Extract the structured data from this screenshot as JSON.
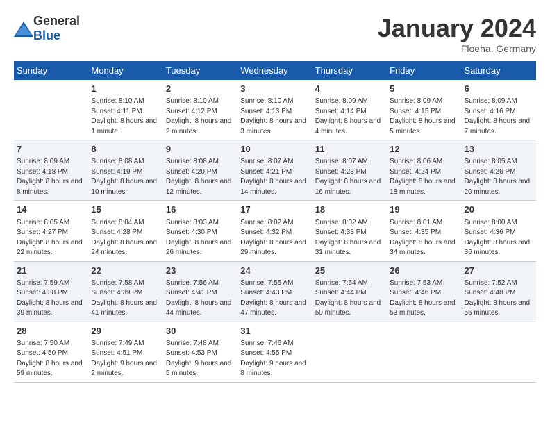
{
  "header": {
    "logo_general": "General",
    "logo_blue": "Blue",
    "month_title": "January 2024",
    "location": "Floeha, Germany"
  },
  "weekdays": [
    "Sunday",
    "Monday",
    "Tuesday",
    "Wednesday",
    "Thursday",
    "Friday",
    "Saturday"
  ],
  "weeks": [
    [
      {
        "day": "",
        "sunrise": "",
        "sunset": "",
        "daylight": ""
      },
      {
        "day": "1",
        "sunrise": "Sunrise: 8:10 AM",
        "sunset": "Sunset: 4:11 PM",
        "daylight": "Daylight: 8 hours and 1 minute."
      },
      {
        "day": "2",
        "sunrise": "Sunrise: 8:10 AM",
        "sunset": "Sunset: 4:12 PM",
        "daylight": "Daylight: 8 hours and 2 minutes."
      },
      {
        "day": "3",
        "sunrise": "Sunrise: 8:10 AM",
        "sunset": "Sunset: 4:13 PM",
        "daylight": "Daylight: 8 hours and 3 minutes."
      },
      {
        "day": "4",
        "sunrise": "Sunrise: 8:09 AM",
        "sunset": "Sunset: 4:14 PM",
        "daylight": "Daylight: 8 hours and 4 minutes."
      },
      {
        "day": "5",
        "sunrise": "Sunrise: 8:09 AM",
        "sunset": "Sunset: 4:15 PM",
        "daylight": "Daylight: 8 hours and 5 minutes."
      },
      {
        "day": "6",
        "sunrise": "Sunrise: 8:09 AM",
        "sunset": "Sunset: 4:16 PM",
        "daylight": "Daylight: 8 hours and 7 minutes."
      }
    ],
    [
      {
        "day": "7",
        "sunrise": "Sunrise: 8:09 AM",
        "sunset": "Sunset: 4:18 PM",
        "daylight": "Daylight: 8 hours and 8 minutes."
      },
      {
        "day": "8",
        "sunrise": "Sunrise: 8:08 AM",
        "sunset": "Sunset: 4:19 PM",
        "daylight": "Daylight: 8 hours and 10 minutes."
      },
      {
        "day": "9",
        "sunrise": "Sunrise: 8:08 AM",
        "sunset": "Sunset: 4:20 PM",
        "daylight": "Daylight: 8 hours and 12 minutes."
      },
      {
        "day": "10",
        "sunrise": "Sunrise: 8:07 AM",
        "sunset": "Sunset: 4:21 PM",
        "daylight": "Daylight: 8 hours and 14 minutes."
      },
      {
        "day": "11",
        "sunrise": "Sunrise: 8:07 AM",
        "sunset": "Sunset: 4:23 PM",
        "daylight": "Daylight: 8 hours and 16 minutes."
      },
      {
        "day": "12",
        "sunrise": "Sunrise: 8:06 AM",
        "sunset": "Sunset: 4:24 PM",
        "daylight": "Daylight: 8 hours and 18 minutes."
      },
      {
        "day": "13",
        "sunrise": "Sunrise: 8:05 AM",
        "sunset": "Sunset: 4:26 PM",
        "daylight": "Daylight: 8 hours and 20 minutes."
      }
    ],
    [
      {
        "day": "14",
        "sunrise": "Sunrise: 8:05 AM",
        "sunset": "Sunset: 4:27 PM",
        "daylight": "Daylight: 8 hours and 22 minutes."
      },
      {
        "day": "15",
        "sunrise": "Sunrise: 8:04 AM",
        "sunset": "Sunset: 4:28 PM",
        "daylight": "Daylight: 8 hours and 24 minutes."
      },
      {
        "day": "16",
        "sunrise": "Sunrise: 8:03 AM",
        "sunset": "Sunset: 4:30 PM",
        "daylight": "Daylight: 8 hours and 26 minutes."
      },
      {
        "day": "17",
        "sunrise": "Sunrise: 8:02 AM",
        "sunset": "Sunset: 4:32 PM",
        "daylight": "Daylight: 8 hours and 29 minutes."
      },
      {
        "day": "18",
        "sunrise": "Sunrise: 8:02 AM",
        "sunset": "Sunset: 4:33 PM",
        "daylight": "Daylight: 8 hours and 31 minutes."
      },
      {
        "day": "19",
        "sunrise": "Sunrise: 8:01 AM",
        "sunset": "Sunset: 4:35 PM",
        "daylight": "Daylight: 8 hours and 34 minutes."
      },
      {
        "day": "20",
        "sunrise": "Sunrise: 8:00 AM",
        "sunset": "Sunset: 4:36 PM",
        "daylight": "Daylight: 8 hours and 36 minutes."
      }
    ],
    [
      {
        "day": "21",
        "sunrise": "Sunrise: 7:59 AM",
        "sunset": "Sunset: 4:38 PM",
        "daylight": "Daylight: 8 hours and 39 minutes."
      },
      {
        "day": "22",
        "sunrise": "Sunrise: 7:58 AM",
        "sunset": "Sunset: 4:39 PM",
        "daylight": "Daylight: 8 hours and 41 minutes."
      },
      {
        "day": "23",
        "sunrise": "Sunrise: 7:56 AM",
        "sunset": "Sunset: 4:41 PM",
        "daylight": "Daylight: 8 hours and 44 minutes."
      },
      {
        "day": "24",
        "sunrise": "Sunrise: 7:55 AM",
        "sunset": "Sunset: 4:43 PM",
        "daylight": "Daylight: 8 hours and 47 minutes."
      },
      {
        "day": "25",
        "sunrise": "Sunrise: 7:54 AM",
        "sunset": "Sunset: 4:44 PM",
        "daylight": "Daylight: 8 hours and 50 minutes."
      },
      {
        "day": "26",
        "sunrise": "Sunrise: 7:53 AM",
        "sunset": "Sunset: 4:46 PM",
        "daylight": "Daylight: 8 hours and 53 minutes."
      },
      {
        "day": "27",
        "sunrise": "Sunrise: 7:52 AM",
        "sunset": "Sunset: 4:48 PM",
        "daylight": "Daylight: 8 hours and 56 minutes."
      }
    ],
    [
      {
        "day": "28",
        "sunrise": "Sunrise: 7:50 AM",
        "sunset": "Sunset: 4:50 PM",
        "daylight": "Daylight: 8 hours and 59 minutes."
      },
      {
        "day": "29",
        "sunrise": "Sunrise: 7:49 AM",
        "sunset": "Sunset: 4:51 PM",
        "daylight": "Daylight: 9 hours and 2 minutes."
      },
      {
        "day": "30",
        "sunrise": "Sunrise: 7:48 AM",
        "sunset": "Sunset: 4:53 PM",
        "daylight": "Daylight: 9 hours and 5 minutes."
      },
      {
        "day": "31",
        "sunrise": "Sunrise: 7:46 AM",
        "sunset": "Sunset: 4:55 PM",
        "daylight": "Daylight: 9 hours and 8 minutes."
      },
      {
        "day": "",
        "sunrise": "",
        "sunset": "",
        "daylight": ""
      },
      {
        "day": "",
        "sunrise": "",
        "sunset": "",
        "daylight": ""
      },
      {
        "day": "",
        "sunrise": "",
        "sunset": "",
        "daylight": ""
      }
    ]
  ]
}
